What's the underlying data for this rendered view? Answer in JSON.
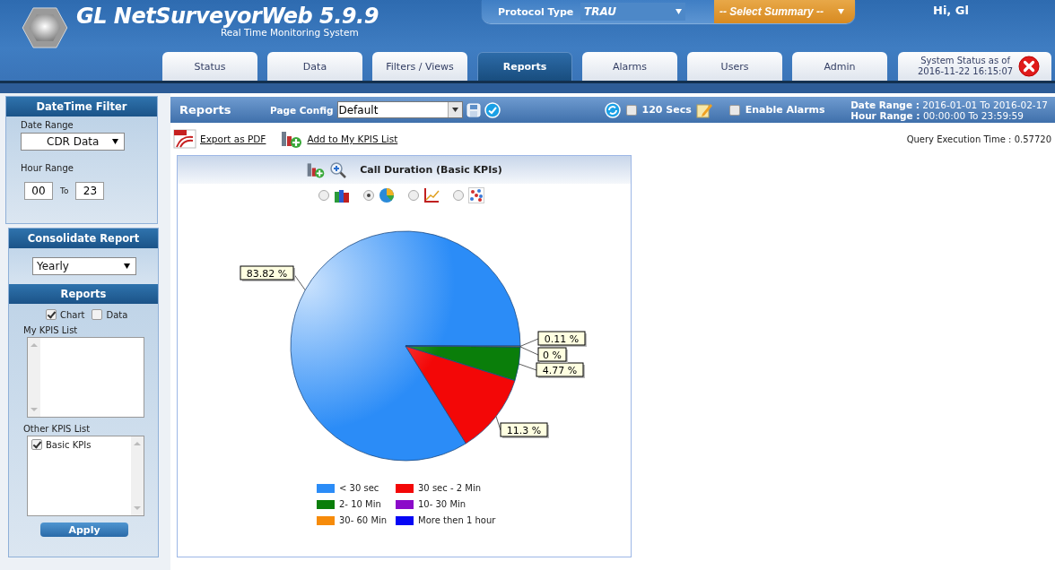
{
  "header": {
    "title": "GL NetSurveyorWeb 5.9.9",
    "subtitle": "Real Time Monitoring System",
    "protocol_label": "Protocol Type",
    "protocol_value": "TRAU",
    "summary_select": "-- Select Summary --",
    "greeting": "Hi, Gl"
  },
  "nav_tabs": [
    {
      "label": "Status",
      "selected": false
    },
    {
      "label": "Data",
      "selected": false
    },
    {
      "label": "Filters / Views",
      "selected": false
    },
    {
      "label": "Reports",
      "selected": true
    },
    {
      "label": "Alarms",
      "selected": false
    },
    {
      "label": "Users",
      "selected": false
    },
    {
      "label": "Admin",
      "selected": false
    }
  ],
  "system_status": {
    "line_1": "System Status as of",
    "line_2": "2016-11-22 16:15:07"
  },
  "sidebar": {
    "datetime_filter": {
      "title": "DateTime Filter",
      "date_range_label": "Date Range",
      "date_range_value": "CDR Data",
      "hour_range_label": "Hour Range",
      "hour_from": "00",
      "to_label": "To",
      "hour_to": "23"
    },
    "consolidate": {
      "title": "Consolidate Report",
      "value": "Yearly"
    },
    "reports": {
      "title": "Reports",
      "options": [
        {
          "label": "Chart",
          "checked": true
        },
        {
          "label": "Data",
          "checked": false
        }
      ],
      "my_kpis_label": "My KPIS List",
      "other_kpis_label": "Other KPIS List",
      "other_kpis": [
        {
          "label": "Basic KPIs",
          "checked": true
        }
      ],
      "apply": "Apply"
    }
  },
  "toolbar": {
    "title": "Reports",
    "page_config_label": "Page Config",
    "page_config_value": "Default",
    "refresh_label": "120 Secs",
    "refresh_checked": false,
    "alarms_label": "Enable Alarms",
    "alarms_checked": false,
    "date_range": "Date Range :",
    "date_range_value": "2016-01-01 To 2016-02-17",
    "hour_range": "Hour Range :",
    "hour_range_value": "00:00:00 To 23:59:59"
  },
  "actions": {
    "export_pdf": "Export as PDF",
    "add_kpis": "Add to My KPIS List",
    "query_time": "Query Execution Time : 0.57720"
  },
  "chart_panel": {
    "chart_types": [
      {
        "kind": "bar",
        "selected": false
      },
      {
        "kind": "pie",
        "selected": true
      },
      {
        "kind": "line",
        "selected": false
      },
      {
        "kind": "scatter",
        "selected": false
      }
    ],
    "slice_colors": [
      {
        "color": "#2b8cf7"
      },
      {
        "color": "#f30707"
      },
      {
        "color": "#0a7e0a"
      },
      {
        "color": "#8b0ac9"
      },
      {
        "color": "#f68b0a"
      },
      {
        "color": "#0606f5"
      }
    ],
    "chart_data": {
      "type": "pie",
      "title": "Call Duration (Basic KPIs)",
      "categories": [
        "< 30 sec",
        "30 sec - 2 Min",
        "2- 10 Min",
        "10- 30 Min",
        "30- 60 Min",
        "More then 1 hour"
      ],
      "series": [
        {
          "values": [
            83.82,
            11.3,
            4.77,
            0,
            0.11,
            null
          ]
        }
      ],
      "value_labels": [
        "83.82 %",
        "11.3 %",
        "4.77 %",
        "0 %",
        "0.11 %",
        null
      ],
      "legend": "bottom"
    }
  }
}
